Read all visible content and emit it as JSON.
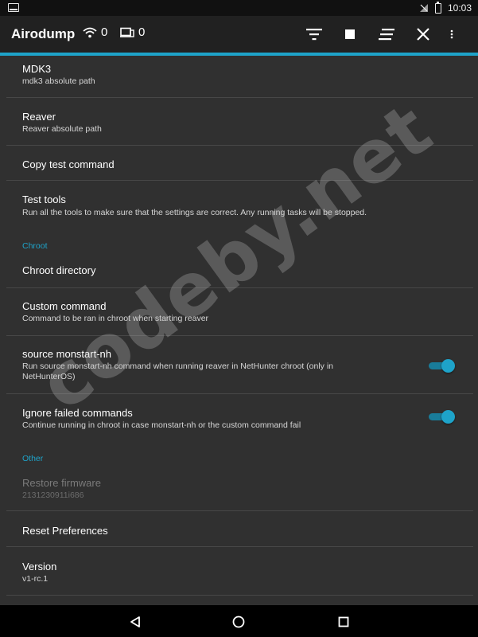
{
  "status_bar": {
    "time": "10:03",
    "icons": [
      "screen-icon",
      "no-sim-icon",
      "battery-charging-icon"
    ]
  },
  "app_bar": {
    "title": "Airodump",
    "wifi_count": "0",
    "device_count": "0",
    "actions": [
      "filter-icon",
      "stop-icon",
      "sort-icon",
      "close-icon",
      "more-vert-icon"
    ]
  },
  "accent_color": "#1ea3c9",
  "preferences": {
    "mdk3": {
      "title": "MDK3",
      "summary": "mdk3 absolute path"
    },
    "reaver": {
      "title": "Reaver",
      "summary": "Reaver absolute path"
    },
    "copy_test": {
      "title": "Copy test command"
    },
    "test_tools": {
      "title": "Test tools",
      "summary": "Run all the tools to make sure that the settings are correct. Any running tasks will be stopped."
    },
    "chroot_category": "Chroot",
    "chroot_dir": {
      "title": "Chroot directory"
    },
    "custom_command": {
      "title": "Custom command",
      "summary": "Command to be ran in chroot when starting reaver"
    },
    "source_monstart": {
      "title": "source monstart-nh",
      "summary_line1": "Run source monstart-nh command when running reaver in NetHunter chroot (only in",
      "summary_line2": "NetHunterOS)",
      "enabled": true
    },
    "ignore_failed": {
      "title": "Ignore failed commands",
      "summary": "Continue running in chroot in case monstart-nh or the custom command fail",
      "enabled": true
    },
    "other_category": "Other",
    "restore_firmware": {
      "title": "Restore firmware",
      "summary": "2131230911i686"
    },
    "reset_prefs": {
      "title": "Reset Preferences"
    },
    "version": {
      "title": "Version",
      "summary": "v1-rc.1"
    }
  },
  "watermark": "codeby.net",
  "nav_bar": [
    "back-icon",
    "home-icon",
    "recents-icon"
  ]
}
